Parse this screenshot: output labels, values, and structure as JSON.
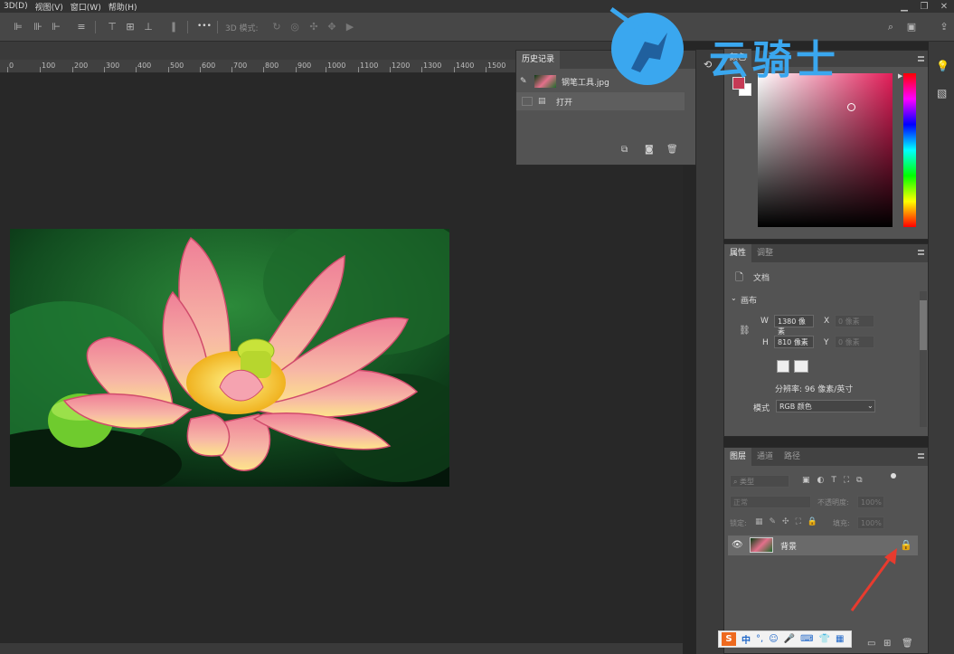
{
  "menubar": {
    "items": [
      "3D(D)",
      "视图(V)",
      "窗口(W)",
      "帮助(H)"
    ]
  },
  "optionsbar": {
    "mode_3d_label": "3D 模式:",
    "more_label": "•••"
  },
  "ruler": {
    "ticks": [
      "0",
      "100",
      "200",
      "300",
      "400",
      "500",
      "600",
      "700",
      "800",
      "900",
      "1000",
      "1100",
      "1200",
      "1300",
      "1400",
      "1500"
    ]
  },
  "history": {
    "tab_label": "历史记录",
    "snapshot_label": "钢笔工具.jpg",
    "step_label": "打开"
  },
  "color": {
    "tab_visible_label": "颜色",
    "foreground_color": "#c63a55",
    "background_color": "#ffffff",
    "spectrum_hue": "#e31e59"
  },
  "properties": {
    "tabs": [
      "属性",
      "调整"
    ],
    "doc_label": "文档",
    "section_label": "画布",
    "width_label": "W",
    "width_value": "1380 像素",
    "height_label": "H",
    "height_value": "810 像素",
    "x_label": "X",
    "x_placeholder": "0 像素",
    "y_label": "Y",
    "y_placeholder": "0 像素",
    "resolution_label": "分辨率: 96 像素/英寸",
    "mode_label": "模式",
    "mode_value": "RGB 颜色"
  },
  "layers": {
    "tabs": [
      "图层",
      "通道",
      "路径"
    ],
    "filter_placeholder": "类型",
    "blend_mode": "正常",
    "opacity_label": "不透明度:",
    "opacity_value": "100%",
    "lock_label": "锁定:",
    "fill_label": "填充:",
    "fill_value": "100%",
    "layer_name": "背景"
  },
  "watermark": {
    "text": "云骑士"
  },
  "ime": {
    "mode_label": "中"
  }
}
